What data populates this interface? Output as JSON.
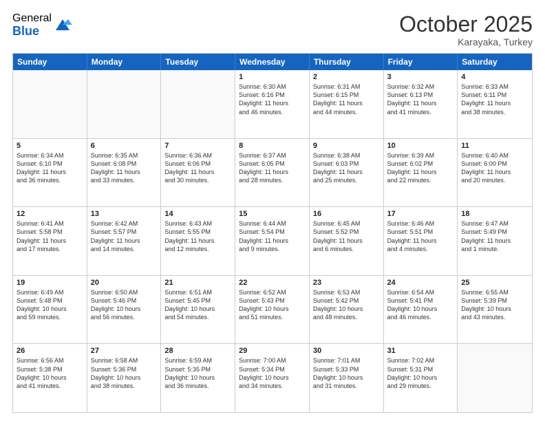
{
  "logo": {
    "general": "General",
    "blue": "Blue"
  },
  "title": "October 2025",
  "location": "Karayaka, Turkey",
  "days": [
    "Sunday",
    "Monday",
    "Tuesday",
    "Wednesday",
    "Thursday",
    "Friday",
    "Saturday"
  ],
  "rows": [
    [
      {
        "day": "",
        "info": ""
      },
      {
        "day": "",
        "info": ""
      },
      {
        "day": "",
        "info": ""
      },
      {
        "day": "1",
        "info": "Sunrise: 6:30 AM\nSunset: 6:16 PM\nDaylight: 11 hours\nand 46 minutes."
      },
      {
        "day": "2",
        "info": "Sunrise: 6:31 AM\nSunset: 6:15 PM\nDaylight: 11 hours\nand 44 minutes."
      },
      {
        "day": "3",
        "info": "Sunrise: 6:32 AM\nSunset: 6:13 PM\nDaylight: 11 hours\nand 41 minutes."
      },
      {
        "day": "4",
        "info": "Sunrise: 6:33 AM\nSunset: 6:11 PM\nDaylight: 11 hours\nand 38 minutes."
      }
    ],
    [
      {
        "day": "5",
        "info": "Sunrise: 6:34 AM\nSunset: 6:10 PM\nDaylight: 11 hours\nand 36 minutes."
      },
      {
        "day": "6",
        "info": "Sunrise: 6:35 AM\nSunset: 6:08 PM\nDaylight: 11 hours\nand 33 minutes."
      },
      {
        "day": "7",
        "info": "Sunrise: 6:36 AM\nSunset: 6:06 PM\nDaylight: 11 hours\nand 30 minutes."
      },
      {
        "day": "8",
        "info": "Sunrise: 6:37 AM\nSunset: 6:05 PM\nDaylight: 11 hours\nand 28 minutes."
      },
      {
        "day": "9",
        "info": "Sunrise: 6:38 AM\nSunset: 6:03 PM\nDaylight: 11 hours\nand 25 minutes."
      },
      {
        "day": "10",
        "info": "Sunrise: 6:39 AM\nSunset: 6:02 PM\nDaylight: 11 hours\nand 22 minutes."
      },
      {
        "day": "11",
        "info": "Sunrise: 6:40 AM\nSunset: 6:00 PM\nDaylight: 11 hours\nand 20 minutes."
      }
    ],
    [
      {
        "day": "12",
        "info": "Sunrise: 6:41 AM\nSunset: 5:58 PM\nDaylight: 11 hours\nand 17 minutes."
      },
      {
        "day": "13",
        "info": "Sunrise: 6:42 AM\nSunset: 5:57 PM\nDaylight: 11 hours\nand 14 minutes."
      },
      {
        "day": "14",
        "info": "Sunrise: 6:43 AM\nSunset: 5:55 PM\nDaylight: 11 hours\nand 12 minutes."
      },
      {
        "day": "15",
        "info": "Sunrise: 6:44 AM\nSunset: 5:54 PM\nDaylight: 11 hours\nand 9 minutes."
      },
      {
        "day": "16",
        "info": "Sunrise: 6:45 AM\nSunset: 5:52 PM\nDaylight: 11 hours\nand 6 minutes."
      },
      {
        "day": "17",
        "info": "Sunrise: 6:46 AM\nSunset: 5:51 PM\nDaylight: 11 hours\nand 4 minutes."
      },
      {
        "day": "18",
        "info": "Sunrise: 6:47 AM\nSunset: 5:49 PM\nDaylight: 11 hours\nand 1 minute."
      }
    ],
    [
      {
        "day": "19",
        "info": "Sunrise: 6:49 AM\nSunset: 5:48 PM\nDaylight: 10 hours\nand 59 minutes."
      },
      {
        "day": "20",
        "info": "Sunrise: 6:50 AM\nSunset: 5:46 PM\nDaylight: 10 hours\nand 56 minutes."
      },
      {
        "day": "21",
        "info": "Sunrise: 6:51 AM\nSunset: 5:45 PM\nDaylight: 10 hours\nand 54 minutes."
      },
      {
        "day": "22",
        "info": "Sunrise: 6:52 AM\nSunset: 5:43 PM\nDaylight: 10 hours\nand 51 minutes."
      },
      {
        "day": "23",
        "info": "Sunrise: 6:53 AM\nSunset: 5:42 PM\nDaylight: 10 hours\nand 48 minutes."
      },
      {
        "day": "24",
        "info": "Sunrise: 6:54 AM\nSunset: 5:41 PM\nDaylight: 10 hours\nand 46 minutes."
      },
      {
        "day": "25",
        "info": "Sunrise: 6:55 AM\nSunset: 5:39 PM\nDaylight: 10 hours\nand 43 minutes."
      }
    ],
    [
      {
        "day": "26",
        "info": "Sunrise: 6:56 AM\nSunset: 5:38 PM\nDaylight: 10 hours\nand 41 minutes."
      },
      {
        "day": "27",
        "info": "Sunrise: 6:58 AM\nSunset: 5:36 PM\nDaylight: 10 hours\nand 38 minutes."
      },
      {
        "day": "28",
        "info": "Sunrise: 6:59 AM\nSunset: 5:35 PM\nDaylight: 10 hours\nand 36 minutes."
      },
      {
        "day": "29",
        "info": "Sunrise: 7:00 AM\nSunset: 5:34 PM\nDaylight: 10 hours\nand 34 minutes."
      },
      {
        "day": "30",
        "info": "Sunrise: 7:01 AM\nSunset: 5:33 PM\nDaylight: 10 hours\nand 31 minutes."
      },
      {
        "day": "31",
        "info": "Sunrise: 7:02 AM\nSunset: 5:31 PM\nDaylight: 10 hours\nand 29 minutes."
      },
      {
        "day": "",
        "info": ""
      }
    ]
  ]
}
